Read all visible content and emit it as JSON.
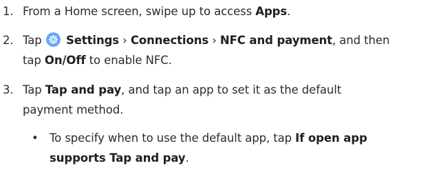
{
  "steps": [
    {
      "number": "1.",
      "pre": "From a Home screen, swipe up to access ",
      "apps": "Apps",
      "post": "."
    },
    {
      "number": "2.",
      "tap": "Tap ",
      "icon": "gear-icon",
      "settings": "Settings",
      "sep1": " › ",
      "connections": "Connections",
      "sep2": " › ",
      "nfc": "NFC and payment",
      "mid": ", and then",
      "tap2": "tap ",
      "onoff": "On/Off",
      "post": " to enable NFC."
    },
    {
      "number": "3.",
      "tap": "Tap ",
      "tapandpay": "Tap and pay",
      "post1": ", and tap an app to set it as the default",
      "post2": "payment method."
    }
  ],
  "bullet": {
    "symbol": "•",
    "pre": "To specify when to use the default app, tap ",
    "bold1": "If open app",
    "bold2": "supports Tap and pay",
    "post": "."
  },
  "colors": {
    "icon_background": "#6aa6f2"
  }
}
